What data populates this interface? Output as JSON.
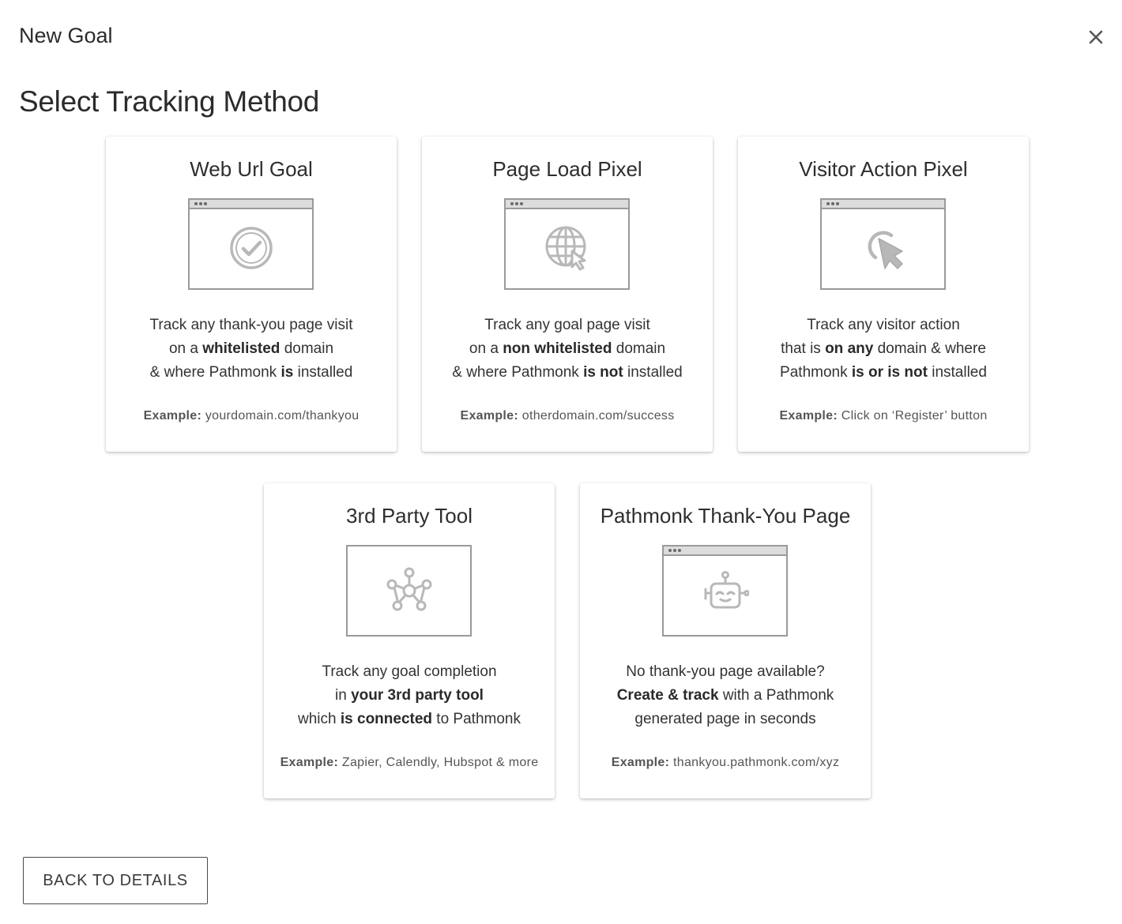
{
  "dialog": {
    "title": "New Goal",
    "close_icon": "close-icon"
  },
  "page": {
    "title": "Select Tracking Method"
  },
  "cards": [
    {
      "title": "Web Url Goal",
      "icon": "check-circle-icon",
      "lines": [
        [
          {
            "t": "Track any thank-you page visit"
          }
        ],
        [
          {
            "t": "on a "
          },
          {
            "t": "whitelisted",
            "b": true
          },
          {
            "t": " domain"
          }
        ],
        [
          {
            "t": "& where Pathmonk "
          },
          {
            "t": "is",
            "b": true
          },
          {
            "t": " installed"
          }
        ]
      ],
      "example_label": "Example:",
      "example_value": "yourdomain.com/thankyou"
    },
    {
      "title": "Page Load Pixel",
      "icon": "globe-cursor-icon",
      "lines": [
        [
          {
            "t": "Track any goal page visit"
          }
        ],
        [
          {
            "t": "on a "
          },
          {
            "t": "non whitelisted",
            "b": true
          },
          {
            "t": " domain"
          }
        ],
        [
          {
            "t": "& where Pathmonk "
          },
          {
            "t": "is not",
            "b": true
          },
          {
            "t": " installed"
          }
        ]
      ],
      "example_label": "Example:",
      "example_value": "otherdomain.com/success"
    },
    {
      "title": "Visitor Action Pixel",
      "icon": "click-cursor-icon",
      "lines": [
        [
          {
            "t": "Track any visitor action"
          }
        ],
        [
          {
            "t": "that is "
          },
          {
            "t": "on any",
            "b": true
          },
          {
            "t": " domain & where"
          }
        ],
        [
          {
            "t": "Pathmonk "
          },
          {
            "t": "is or is not",
            "b": true
          },
          {
            "t": " installed"
          }
        ]
      ],
      "example_label": "Example:",
      "example_value": "Click on ‘Register’ button"
    },
    {
      "title": "3rd Party Tool",
      "icon": "network-hub-icon",
      "lines": [
        [
          {
            "t": "Track any goal completion"
          }
        ],
        [
          {
            "t": "in "
          },
          {
            "t": "your 3rd party tool",
            "b": true
          }
        ],
        [
          {
            "t": "which "
          },
          {
            "t": "is connected",
            "b": true
          },
          {
            "t": " to Pathmonk"
          }
        ]
      ],
      "example_label": "Example:",
      "example_value": "Zapier, Calendly, Hubspot & more"
    },
    {
      "title": "Pathmonk Thank-You Page",
      "icon": "robot-icon",
      "lines": [
        [
          {
            "t": "No thank-you page available?"
          }
        ],
        [
          {
            "t": "Create & track",
            "b": true
          },
          {
            "t": " with a Pathmonk"
          }
        ],
        [
          {
            "t": "generated page in seconds"
          }
        ]
      ],
      "example_label": "Example:",
      "example_value": "thankyou.pathmonk.com/xyz"
    }
  ],
  "footer": {
    "back_label": "BACK TO DETAILS"
  }
}
